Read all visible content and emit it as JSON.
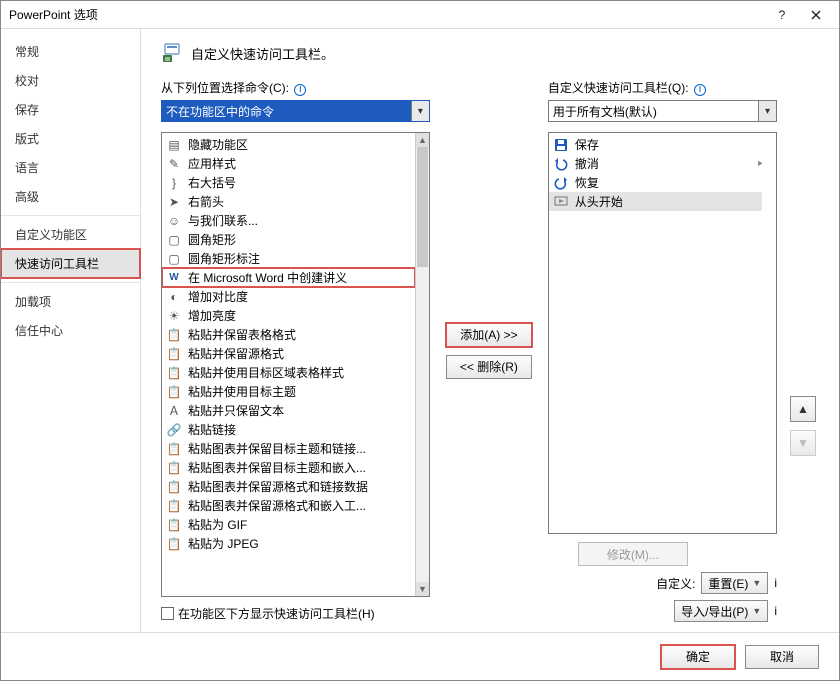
{
  "title": "PowerPoint 选项",
  "sidebar": {
    "items": [
      {
        "label": "常规"
      },
      {
        "label": "校对"
      },
      {
        "label": "保存"
      },
      {
        "label": "版式"
      },
      {
        "label": "语言"
      },
      {
        "label": "高级"
      },
      {
        "label": "自定义功能区"
      },
      {
        "label": "快速访问工具栏"
      },
      {
        "label": "加载项"
      },
      {
        "label": "信任中心"
      }
    ]
  },
  "section_title": "自定义快速访问工具栏。",
  "left": {
    "label": "从下列位置选择命令(C):",
    "combo": "不在功能区中的命令",
    "items": [
      {
        "icon": "hide",
        "label": "隐藏功能区"
      },
      {
        "icon": "brush",
        "label": "应用样式"
      },
      {
        "icon": "brace",
        "label": "右大括号"
      },
      {
        "icon": "arrow-r",
        "label": "右箭头"
      },
      {
        "icon": "contact",
        "label": "与我们联系..."
      },
      {
        "icon": "roundrect",
        "label": "圆角矩形"
      },
      {
        "icon": "callout",
        "label": "圆角矩形标注"
      },
      {
        "icon": "word",
        "label": "在 Microsoft Word 中创建讲义"
      },
      {
        "icon": "contrast",
        "label": "增加对比度"
      },
      {
        "icon": "bright",
        "label": "增加亮度"
      },
      {
        "icon": "paste",
        "label": "粘贴并保留表格格式"
      },
      {
        "icon": "paste",
        "label": "粘贴并保留源格式"
      },
      {
        "icon": "paste",
        "label": "粘贴并使用目标区域表格样式"
      },
      {
        "icon": "paste",
        "label": "粘贴并使用目标主题"
      },
      {
        "icon": "paste-text",
        "label": "粘贴并只保留文本"
      },
      {
        "icon": "link",
        "label": "粘贴链接"
      },
      {
        "icon": "paste",
        "label": "粘贴图表并保留目标主题和链接..."
      },
      {
        "icon": "paste",
        "label": "粘贴图表并保留目标主题和嵌入..."
      },
      {
        "icon": "paste",
        "label": "粘贴图表并保留源格式和链接数据"
      },
      {
        "icon": "paste",
        "label": "粘贴图表并保留源格式和嵌入工..."
      },
      {
        "icon": "paste",
        "label": "粘贴为 GIF"
      },
      {
        "icon": "paste",
        "label": "粘贴为 JPEG"
      }
    ]
  },
  "right": {
    "label": "自定义快速访问工具栏(Q):",
    "combo": "用于所有文档(默认)",
    "items": [
      {
        "icon": "save",
        "label": "保存"
      },
      {
        "icon": "undo",
        "label": "撤消",
        "has_arrow": true
      },
      {
        "icon": "redo",
        "label": "恢复"
      },
      {
        "icon": "start",
        "label": "从头开始"
      }
    ]
  },
  "mid": {
    "add": "添加(A) >>",
    "remove": "<< 删除(R)"
  },
  "below_left_checkbox": "在功能区下方显示快速访问工具栏(H)",
  "below_right": {
    "modify": "修改(M)...",
    "custom_label": "自定义:",
    "reset": "重置(E)",
    "import": "导入/导出(P)"
  },
  "footer": {
    "ok": "确定",
    "cancel": "取消"
  }
}
